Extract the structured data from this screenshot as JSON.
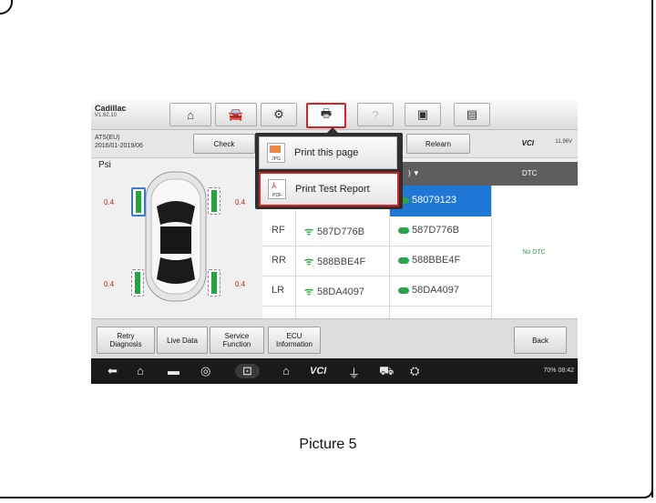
{
  "vehicle": {
    "make": "Cadillac",
    "version": "V1.62.10"
  },
  "model": {
    "line1": "ATS(EU)",
    "line2": "2016/01-2019/06"
  },
  "toolbar": {
    "home_icon": "home-icon",
    "car_icon": "car-icon",
    "settings_icon": "gear-icon",
    "print_icon": "printer-icon",
    "help_icon": "help-icon",
    "save_icon": "save-icon",
    "message_icon": "message-icon"
  },
  "actions": {
    "check": "Check",
    "relearn": "Relearn"
  },
  "vci": {
    "label": "VCI",
    "battery": "11.96V"
  },
  "tires": {
    "unit": "Psi",
    "lf": "0.4",
    "rf": "0.4",
    "lr": "0.4",
    "rr": "0.4"
  },
  "table": {
    "id_header_suffix": ") ▼",
    "dtc_header": "DTC",
    "selected_id": "58079123",
    "rows": [
      {
        "pos": "RF",
        "sensor_id": "587D776B",
        "ecu_id": "587D776B"
      },
      {
        "pos": "RR",
        "sensor_id": "588BBE4F",
        "ecu_id": "588BBE4F"
      },
      {
        "pos": "LR",
        "sensor_id": "58DA4097",
        "ecu_id": "58DA4097"
      }
    ],
    "dtc_status": "No DTC"
  },
  "print_menu": {
    "item1": {
      "label": "Print this page",
      "icon_tag": "JPG"
    },
    "item2": {
      "label": "Print Test Report",
      "icon_tag": "PDF"
    }
  },
  "bottom_buttons": {
    "retry_line1": "Retry",
    "retry_line2": "Diagnosis",
    "live_data": "Live Data",
    "service_line1": "Service",
    "service_line2": "Function",
    "ecu_line1": "ECU",
    "ecu_line2": "Information",
    "back": "Back"
  },
  "status_bar": {
    "battery": "70%",
    "time": "08:42"
  },
  "caption": "Picture 5",
  "colors": {
    "accent_blue": "#1f78d6",
    "highlight_red": "#e02020",
    "ok_green": "#2aa64a"
  }
}
